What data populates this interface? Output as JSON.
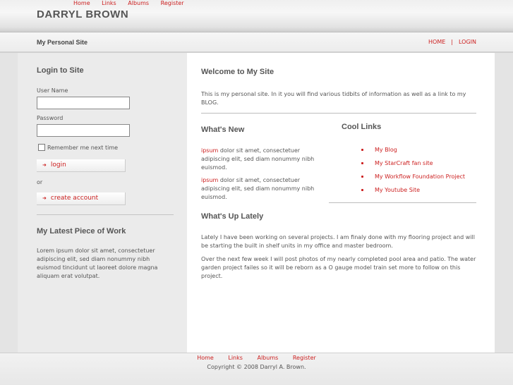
{
  "header": {
    "nav": [
      "Home",
      "Links",
      "Albums",
      "Register"
    ],
    "site_title": "DARRYL BROWN"
  },
  "subheader": {
    "tagline": "My Personal Site",
    "nav": [
      "HOME",
      "LOGIN"
    ],
    "separator": "|"
  },
  "sidebar": {
    "login_title": "Login to Site",
    "username_label": "User Name",
    "username_value": "",
    "password_label": "Password",
    "password_value": "",
    "remember_label": "Remember me next time",
    "remember_checked": false,
    "login_button": "login",
    "or_text": "or",
    "create_button": "create account",
    "work_title": "My Latest Piece of Work",
    "work_text": "Lorem ipsum dolor sit amet, consectetuer adipiscing elit, sed diam nonummy nibh euismod tincidunt ut laoreet dolore magna aliquam erat volutpat."
  },
  "main": {
    "welcome_title": "Welcome to My Site",
    "welcome_text": "This is my personal site. In it you will find various tidbits of information as well as a link to my BLOG.",
    "whats_new_title": "What's New",
    "news": [
      {
        "lead": "ipsum",
        "text": " dolor sit amet, consectetuer adipiscing elit, sed diam nonummy nibh euismod."
      },
      {
        "lead": "ipsum",
        "text": " dolor sit amet, consectetuer adipiscing elit, sed diam nonummy nibh euismod."
      }
    ],
    "cool_links_title": "Cool Links",
    "cool_links": [
      "My Blog",
      "My StarCraft fan site",
      "My Workflow Foundation Project",
      "My Youtube Site"
    ],
    "whats_up_title": "What's Up Lately",
    "whats_up_p1": "Lately I have been working on several projects.  I am finaly done with my flooring project and will be starting the built in shelf units in my office and master bedroom.",
    "whats_up_p2": "Over the next few week I will post photos of my nearly completed pool area and patio.  The water garden project failes so it will be reborn as a O gauge model train set more to follow on this project."
  },
  "footer": {
    "nav": [
      "Home",
      "Links",
      "Albums",
      "Register"
    ],
    "copyright": "Copyright © 2008 Darryl A. Brown."
  },
  "colors": {
    "accent": "#cc1f1f",
    "sidebar_bg": "#ebebeb",
    "text": "#555555"
  }
}
